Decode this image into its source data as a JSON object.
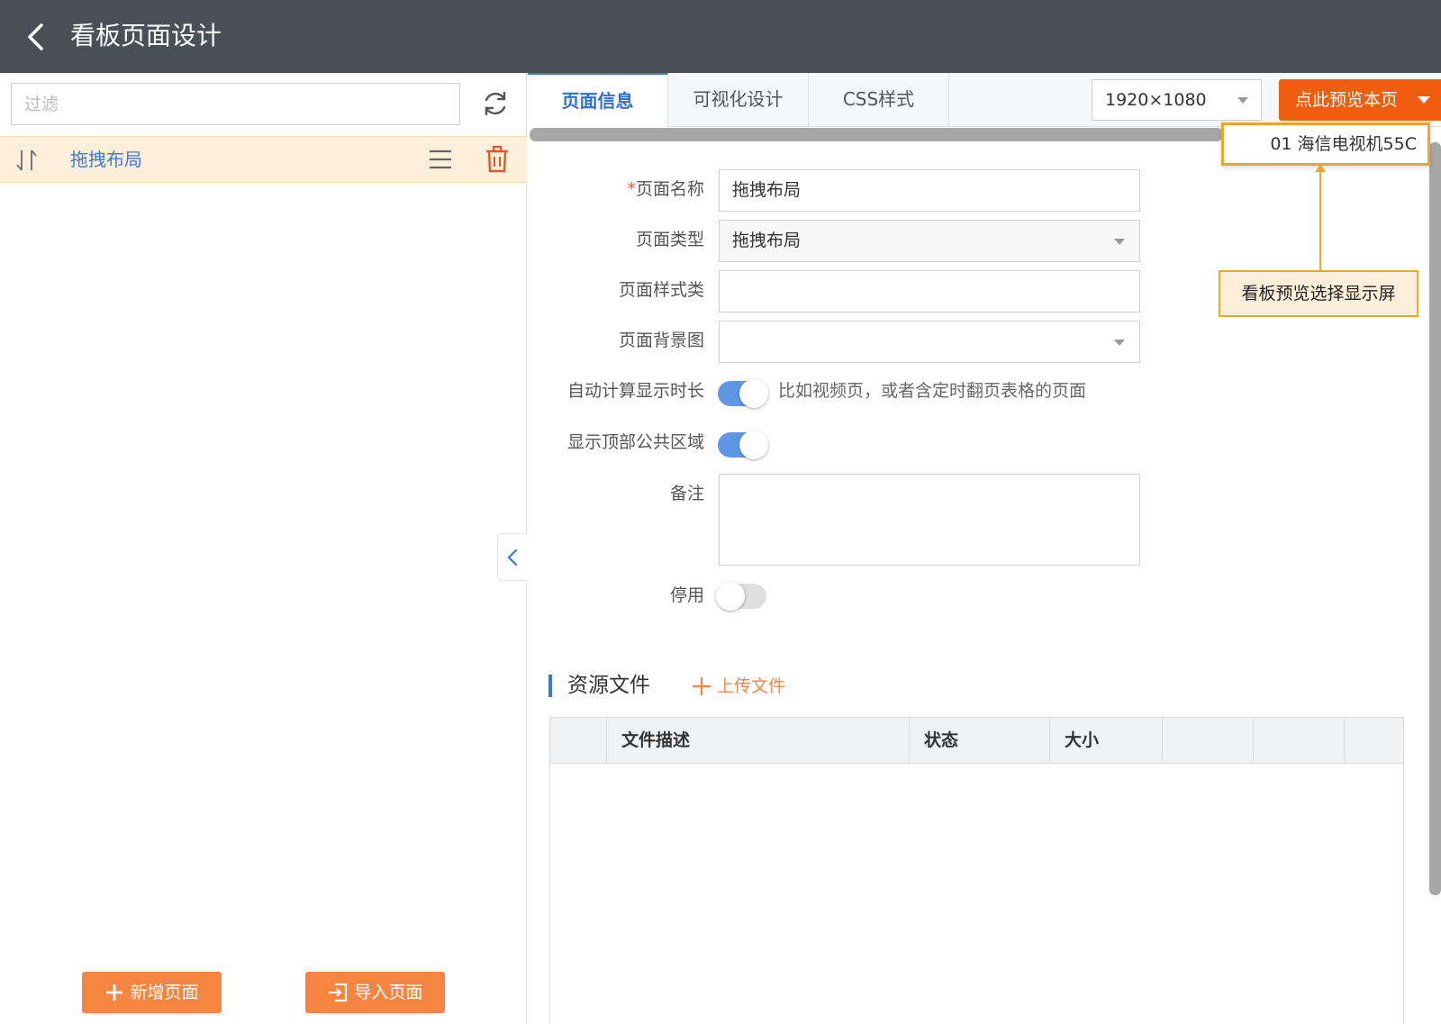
{
  "header": {
    "title": "看板页面设计"
  },
  "sidebar": {
    "filter_placeholder": "过滤",
    "pages": [
      {
        "label": "拖拽布局"
      }
    ],
    "new_page_label": "新增页面",
    "import_page_label": "导入页面"
  },
  "tabs": [
    {
      "label": "页面信息"
    },
    {
      "label": "可视化设计"
    },
    {
      "label": "CSS样式"
    }
  ],
  "toolbar": {
    "resolution": "1920×1080",
    "preview_label": "点此预览本页",
    "dropdown_item": "01 海信电视机55C",
    "annotation": "看板预览选择显示屏"
  },
  "form": {
    "required_mark": "*",
    "name_label": "页面名称",
    "name_value": "拖拽布局",
    "type_label": "页面类型",
    "type_value": "拖拽布局",
    "style_label": "页面样式类",
    "style_value": "",
    "bg_label": "页面背景图",
    "bg_value": "",
    "auto_label": "自动计算显示时长",
    "auto_on": true,
    "auto_hint": "比如视频页，或者含定时翻页表格的页面",
    "top_label": "显示顶部公共区域",
    "top_on": true,
    "remark_label": "备注",
    "remark_value": "",
    "disable_label": "停用",
    "disable_on": false
  },
  "resources": {
    "title": "资源文件",
    "upload_label": "上传文件",
    "columns": [
      "",
      "文件描述",
      "状态",
      "大小",
      "",
      "",
      ""
    ],
    "rows": []
  },
  "colors": {
    "header_bg": "#4b5058",
    "accent_blue": "#3a7ad6",
    "orange": "#f58540",
    "preview_orange": "#f25c0f",
    "annotation": "#f5a524"
  }
}
